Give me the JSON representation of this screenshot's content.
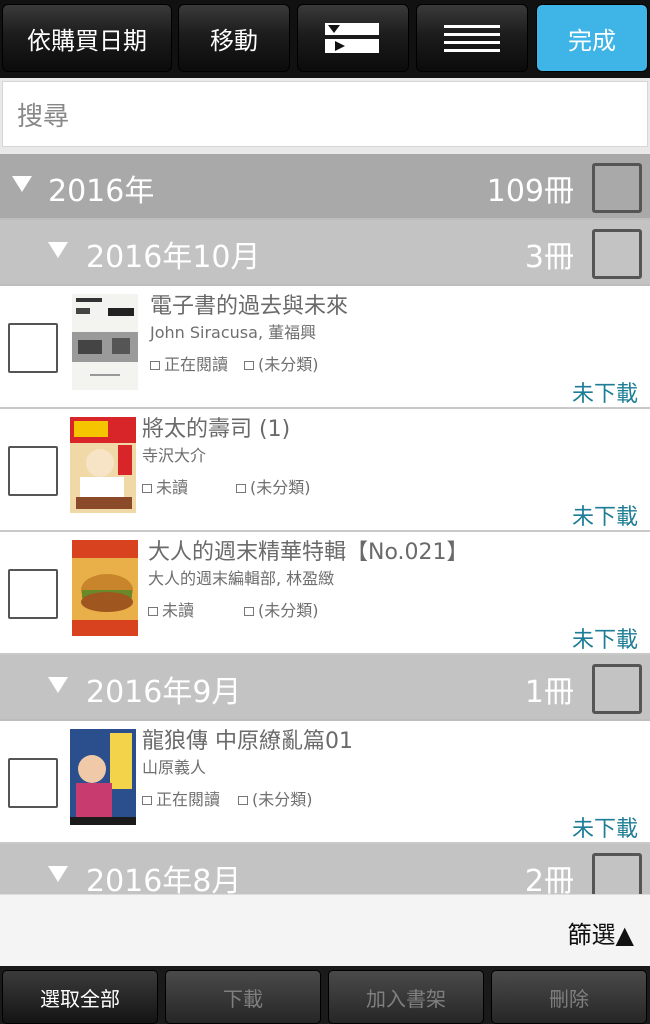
{
  "toolbar": {
    "sort_label": "依購買日期",
    "move_label": "移動",
    "done_label": "完成"
  },
  "search": {
    "placeholder": "搜尋"
  },
  "year_group": {
    "title": "2016年",
    "count": "109冊"
  },
  "months": [
    {
      "title": "2016年10月",
      "count": "3冊"
    },
    {
      "title": "2016年9月",
      "count": "1冊"
    },
    {
      "title": "2016年8月",
      "count": "2冊"
    }
  ],
  "books": [
    {
      "title": "電子書的過去與未來",
      "author": "John Siracusa, 董福興",
      "status": "正在閱讀",
      "category": "(未分類)",
      "download": "未下載",
      "cover_colors": [
        "#f2f2f2",
        "#3b3b3b"
      ]
    },
    {
      "title": "將太的壽司 (1)",
      "author": "寺沢大介",
      "status": "未讀",
      "category": "(未分類)",
      "download": "未下載",
      "cover_colors": [
        "#d8252a",
        "#f0d9a6"
      ]
    },
    {
      "title": "大人的週末精華特輯【No.021】",
      "author": "大人的週末編輯部, 林盈緻",
      "status": "未讀",
      "category": "(未分類)",
      "download": "未下載",
      "cover_colors": [
        "#d9421f",
        "#c9852c"
      ]
    },
    {
      "title": "龍狼傳 中原繚亂篇01",
      "author": "山原義人",
      "status": "正在閱讀",
      "category": "(未分類)",
      "download": "未下載",
      "cover_colors": [
        "#2b4e8c",
        "#c83b6f"
      ]
    }
  ],
  "filter": {
    "label": "篩選▲"
  },
  "bottom": {
    "select_all": "選取全部",
    "download": "下載",
    "add_shelf": "加入書架",
    "delete": "刪除"
  },
  "colors": {
    "accent": "#3fb4e6",
    "download_text": "#1e7d96"
  },
  "icons": [
    "view-toggle-icon",
    "menu-lines-icon",
    "book-icon",
    "shelf-icon",
    "triangle-down-icon"
  ]
}
